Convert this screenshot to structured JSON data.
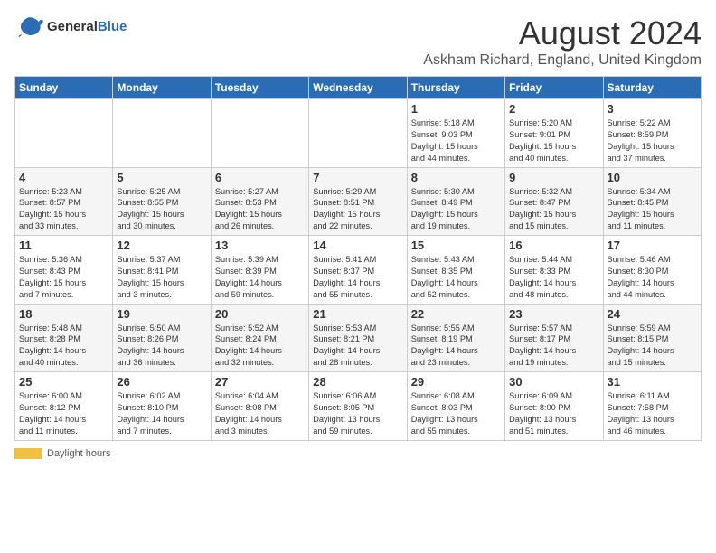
{
  "header": {
    "logo_general": "General",
    "logo_blue": "Blue",
    "title": "August 2024",
    "subtitle": "Askham Richard, England, United Kingdom"
  },
  "calendar": {
    "days_of_week": [
      "Sunday",
      "Monday",
      "Tuesday",
      "Wednesday",
      "Thursday",
      "Friday",
      "Saturday"
    ],
    "weeks": [
      [
        {
          "day": "",
          "info": ""
        },
        {
          "day": "",
          "info": ""
        },
        {
          "day": "",
          "info": ""
        },
        {
          "day": "",
          "info": ""
        },
        {
          "day": "1",
          "info": "Sunrise: 5:18 AM\nSunset: 9:03 PM\nDaylight: 15 hours\nand 44 minutes."
        },
        {
          "day": "2",
          "info": "Sunrise: 5:20 AM\nSunset: 9:01 PM\nDaylight: 15 hours\nand 40 minutes."
        },
        {
          "day": "3",
          "info": "Sunrise: 5:22 AM\nSunset: 8:59 PM\nDaylight: 15 hours\nand 37 minutes."
        }
      ],
      [
        {
          "day": "4",
          "info": "Sunrise: 5:23 AM\nSunset: 8:57 PM\nDaylight: 15 hours\nand 33 minutes."
        },
        {
          "day": "5",
          "info": "Sunrise: 5:25 AM\nSunset: 8:55 PM\nDaylight: 15 hours\nand 30 minutes."
        },
        {
          "day": "6",
          "info": "Sunrise: 5:27 AM\nSunset: 8:53 PM\nDaylight: 15 hours\nand 26 minutes."
        },
        {
          "day": "7",
          "info": "Sunrise: 5:29 AM\nSunset: 8:51 PM\nDaylight: 15 hours\nand 22 minutes."
        },
        {
          "day": "8",
          "info": "Sunrise: 5:30 AM\nSunset: 8:49 PM\nDaylight: 15 hours\nand 19 minutes."
        },
        {
          "day": "9",
          "info": "Sunrise: 5:32 AM\nSunset: 8:47 PM\nDaylight: 15 hours\nand 15 minutes."
        },
        {
          "day": "10",
          "info": "Sunrise: 5:34 AM\nSunset: 8:45 PM\nDaylight: 15 hours\nand 11 minutes."
        }
      ],
      [
        {
          "day": "11",
          "info": "Sunrise: 5:36 AM\nSunset: 8:43 PM\nDaylight: 15 hours\nand 7 minutes."
        },
        {
          "day": "12",
          "info": "Sunrise: 5:37 AM\nSunset: 8:41 PM\nDaylight: 15 hours\nand 3 minutes."
        },
        {
          "day": "13",
          "info": "Sunrise: 5:39 AM\nSunset: 8:39 PM\nDaylight: 14 hours\nand 59 minutes."
        },
        {
          "day": "14",
          "info": "Sunrise: 5:41 AM\nSunset: 8:37 PM\nDaylight: 14 hours\nand 55 minutes."
        },
        {
          "day": "15",
          "info": "Sunrise: 5:43 AM\nSunset: 8:35 PM\nDaylight: 14 hours\nand 52 minutes."
        },
        {
          "day": "16",
          "info": "Sunrise: 5:44 AM\nSunset: 8:33 PM\nDaylight: 14 hours\nand 48 minutes."
        },
        {
          "day": "17",
          "info": "Sunrise: 5:46 AM\nSunset: 8:30 PM\nDaylight: 14 hours\nand 44 minutes."
        }
      ],
      [
        {
          "day": "18",
          "info": "Sunrise: 5:48 AM\nSunset: 8:28 PM\nDaylight: 14 hours\nand 40 minutes."
        },
        {
          "day": "19",
          "info": "Sunrise: 5:50 AM\nSunset: 8:26 PM\nDaylight: 14 hours\nand 36 minutes."
        },
        {
          "day": "20",
          "info": "Sunrise: 5:52 AM\nSunset: 8:24 PM\nDaylight: 14 hours\nand 32 minutes."
        },
        {
          "day": "21",
          "info": "Sunrise: 5:53 AM\nSunset: 8:21 PM\nDaylight: 14 hours\nand 28 minutes."
        },
        {
          "day": "22",
          "info": "Sunrise: 5:55 AM\nSunset: 8:19 PM\nDaylight: 14 hours\nand 23 minutes."
        },
        {
          "day": "23",
          "info": "Sunrise: 5:57 AM\nSunset: 8:17 PM\nDaylight: 14 hours\nand 19 minutes."
        },
        {
          "day": "24",
          "info": "Sunrise: 5:59 AM\nSunset: 8:15 PM\nDaylight: 14 hours\nand 15 minutes."
        }
      ],
      [
        {
          "day": "25",
          "info": "Sunrise: 6:00 AM\nSunset: 8:12 PM\nDaylight: 14 hours\nand 11 minutes."
        },
        {
          "day": "26",
          "info": "Sunrise: 6:02 AM\nSunset: 8:10 PM\nDaylight: 14 hours\nand 7 minutes."
        },
        {
          "day": "27",
          "info": "Sunrise: 6:04 AM\nSunset: 8:08 PM\nDaylight: 14 hours\nand 3 minutes."
        },
        {
          "day": "28",
          "info": "Sunrise: 6:06 AM\nSunset: 8:05 PM\nDaylight: 13 hours\nand 59 minutes."
        },
        {
          "day": "29",
          "info": "Sunrise: 6:08 AM\nSunset: 8:03 PM\nDaylight: 13 hours\nand 55 minutes."
        },
        {
          "day": "30",
          "info": "Sunrise: 6:09 AM\nSunset: 8:00 PM\nDaylight: 13 hours\nand 51 minutes."
        },
        {
          "day": "31",
          "info": "Sunrise: 6:11 AM\nSunset: 7:58 PM\nDaylight: 13 hours\nand 46 minutes."
        }
      ]
    ]
  },
  "legend": {
    "label": "Daylight hours"
  }
}
